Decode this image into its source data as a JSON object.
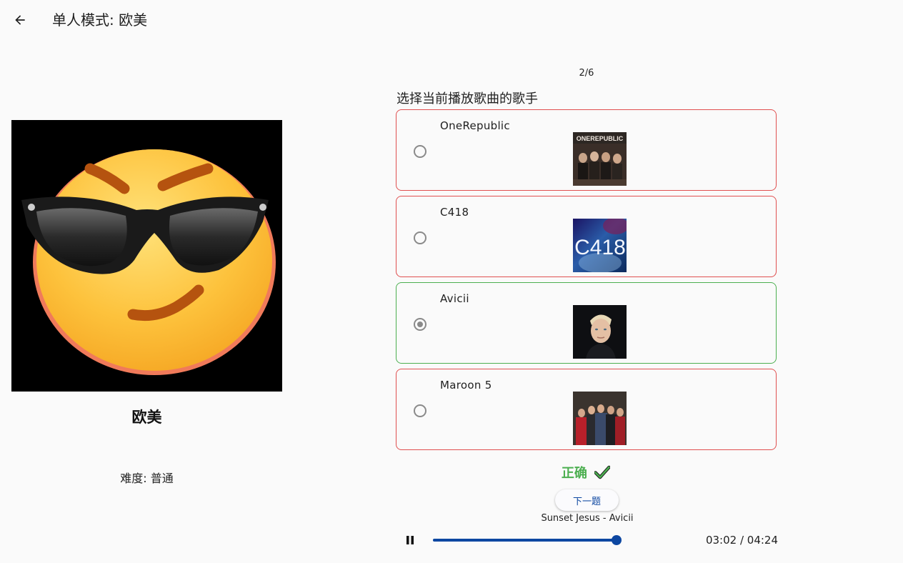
{
  "header": {
    "title": "单人模式: 欧美",
    "back_icon": "arrow-left-icon"
  },
  "left_panel": {
    "category": "欧美",
    "difficulty": "难度: 普通",
    "cover_icon": "smirking-face-with-sunglasses-emoji"
  },
  "quiz": {
    "progress": "2/6",
    "question": "选择当前播放歌曲的歌手",
    "options": [
      {
        "label": "OneRepublic",
        "thumb_text": "ONEREPUBLIC",
        "selected": false,
        "correct": false
      },
      {
        "label": "C418",
        "thumb_text": "C418",
        "selected": false,
        "correct": false
      },
      {
        "label": "Avicii",
        "selected": true,
        "correct": true
      },
      {
        "label": "Maroon 5",
        "selected": false,
        "correct": false
      }
    ],
    "result_label": "正确",
    "next_label": "下一题",
    "song": "Sunset Jesus - Avicii"
  },
  "player": {
    "time_readout": "03:02 / 04:24",
    "progress_fraction": 0.98,
    "pause_icon": "pause-icon"
  },
  "colors": {
    "accent": "#0d47a1",
    "correct": "#4caf50",
    "wrong_border": "#e05050",
    "background": "#fafafa"
  }
}
